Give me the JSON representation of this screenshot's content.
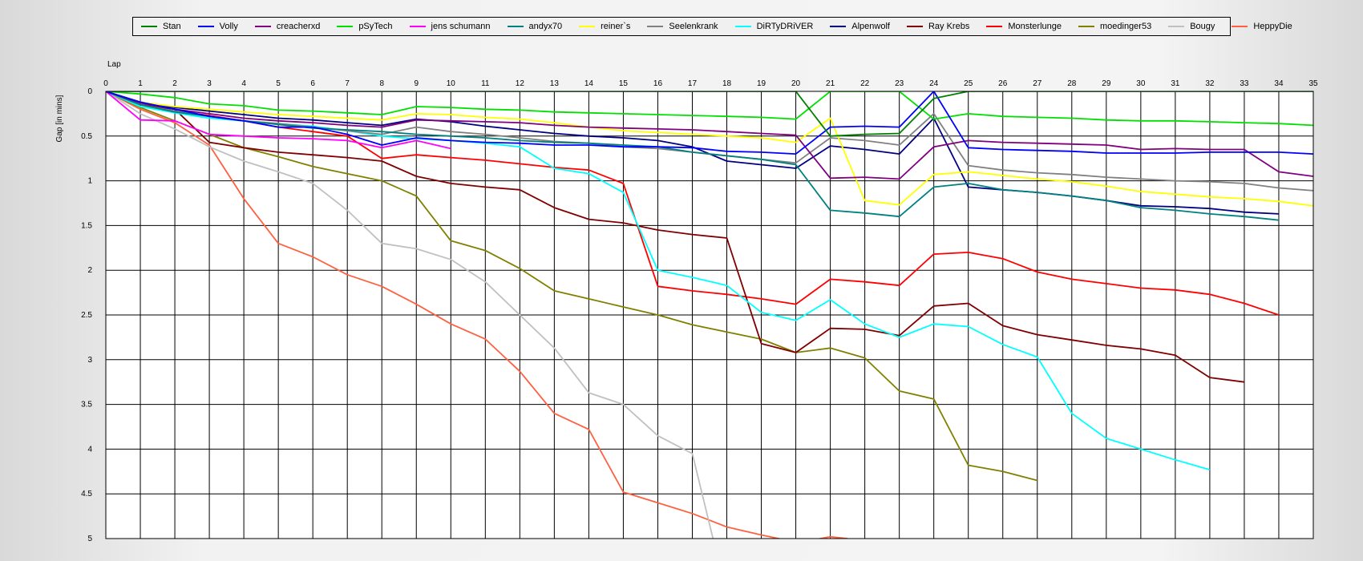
{
  "chart_data": {
    "type": "line",
    "xlabel": "Lap",
    "ylabel": "Gap [in mins]",
    "xlim": [
      0,
      35
    ],
    "ylim": [
      0,
      5
    ],
    "y_inverted": true,
    "grid": true,
    "legend_position": "top",
    "x_ticks": [
      "0",
      "1",
      "2",
      "3",
      "4",
      "5",
      "6",
      "7",
      "8",
      "9",
      "10",
      "11",
      "12",
      "13",
      "14",
      "15",
      "16",
      "17",
      "18",
      "19",
      "20",
      "21",
      "22",
      "23",
      "24",
      "25",
      "26",
      "27",
      "28",
      "29",
      "30",
      "31",
      "32",
      "33",
      "34",
      "35"
    ],
    "y_ticks": [
      "0",
      "0.5",
      "1",
      "1.5",
      "2",
      "2.5",
      "3",
      "3.5",
      "4",
      "4.5",
      "5"
    ],
    "series": [
      {
        "name": "Stan",
        "color": "#008000",
        "x": [
          0,
          1,
          2,
          3,
          4,
          5,
          6,
          7,
          8,
          9,
          10,
          11,
          12,
          13,
          14,
          15,
          16,
          17,
          18,
          19,
          20,
          21,
          22,
          23,
          24,
          25,
          26,
          27,
          28,
          29,
          30,
          31,
          32,
          33,
          34,
          35
        ],
        "values": [
          0,
          0,
          0,
          0,
          0,
          0,
          0,
          0,
          0,
          0,
          0,
          0,
          0,
          0,
          0,
          0,
          0,
          0,
          0,
          0,
          0,
          0.5,
          0.48,
          0.47,
          0.08,
          0,
          0,
          0,
          0,
          0,
          0,
          0,
          0,
          0,
          0,
          0
        ]
      },
      {
        "name": "Volly",
        "color": "#0000ff",
        "x": [
          0,
          1,
          2,
          3,
          4,
          5,
          6,
          7,
          8,
          9,
          10,
          11,
          12,
          13,
          14,
          15,
          16,
          17,
          18,
          19,
          20,
          21,
          22,
          23,
          24,
          25,
          26,
          27,
          28,
          29,
          30,
          31,
          32,
          33,
          34,
          35
        ],
        "values": [
          0,
          0.12,
          0.2,
          0.28,
          0.33,
          0.4,
          0.4,
          0.48,
          0.6,
          0.52,
          0.55,
          0.57,
          0.58,
          0.6,
          0.6,
          0.62,
          0.62,
          0.63,
          0.67,
          0.68,
          0.7,
          0.4,
          0.39,
          0.4,
          0.0,
          0.63,
          0.65,
          0.66,
          0.67,
          0.69,
          0.69,
          0.69,
          0.68,
          0.68,
          0.68,
          0.7
        ]
      },
      {
        "name": "creacherxd",
        "color": "#800080",
        "x": [
          0,
          1,
          2,
          3,
          4,
          5,
          6,
          7,
          8,
          9,
          10,
          11,
          12,
          13,
          14,
          15,
          16,
          17,
          18,
          19,
          20,
          21,
          22,
          23,
          24,
          25,
          26,
          27,
          28,
          29,
          30,
          31,
          32,
          33,
          34,
          35
        ],
        "values": [
          0,
          0.13,
          0.2,
          0.25,
          0.3,
          0.33,
          0.35,
          0.38,
          0.4,
          0.32,
          0.33,
          0.34,
          0.35,
          0.38,
          0.4,
          0.41,
          0.42,
          0.43,
          0.45,
          0.47,
          0.49,
          0.97,
          0.96,
          0.98,
          0.62,
          0.55,
          0.57,
          0.58,
          0.59,
          0.6,
          0.65,
          0.64,
          0.65,
          0.65,
          0.9,
          0.95
        ]
      },
      {
        "name": "pSyTech",
        "color": "#00e000",
        "x": [
          0,
          1,
          2,
          3,
          4,
          5,
          6,
          7,
          8,
          9,
          10,
          11,
          12,
          13,
          14,
          15,
          16,
          17,
          18,
          19,
          20,
          21,
          22,
          23,
          24,
          25,
          26,
          27,
          28,
          29,
          30,
          31,
          32,
          33,
          34,
          35
        ],
        "values": [
          0,
          0.03,
          0.07,
          0.14,
          0.16,
          0.21,
          0.22,
          0.24,
          0.26,
          0.17,
          0.18,
          0.2,
          0.21,
          0.23,
          0.24,
          0.25,
          0.26,
          0.27,
          0.28,
          0.29,
          0.31,
          0.0,
          0.0,
          0.0,
          0.31,
          0.25,
          0.28,
          0.29,
          0.3,
          0.32,
          0.33,
          0.33,
          0.34,
          0.35,
          0.36,
          0.38
        ]
      },
      {
        "name": "jens  schumann",
        "color": "#ff00ff",
        "x": [
          0,
          1,
          2,
          3,
          4,
          5,
          6,
          7,
          8,
          9,
          10
        ],
        "values": [
          0,
          0.32,
          0.33,
          0.48,
          0.5,
          0.52,
          0.53,
          0.55,
          0.63,
          0.55,
          0.64
        ]
      },
      {
        "name": "andyx70",
        "color": "#008080",
        "x": [
          0,
          1,
          2,
          3,
          4,
          5,
          6,
          7,
          8,
          9,
          10,
          11,
          12,
          13,
          14,
          15,
          16,
          17,
          18,
          19,
          20,
          21,
          22,
          23,
          24,
          25,
          26,
          27,
          28,
          29,
          30,
          31,
          32,
          33,
          34
        ],
        "values": [
          0,
          0.15,
          0.23,
          0.28,
          0.33,
          0.37,
          0.41,
          0.43,
          0.45,
          0.48,
          0.5,
          0.52,
          0.55,
          0.57,
          0.58,
          0.6,
          0.62,
          0.68,
          0.72,
          0.76,
          0.82,
          1.33,
          1.36,
          1.4,
          1.07,
          1.03,
          1.1,
          1.13,
          1.17,
          1.22,
          1.3,
          1.33,
          1.37,
          1.4,
          1.44
        ]
      },
      {
        "name": "reiner`s",
        "color": "#ffff00",
        "x": [
          0,
          1,
          2,
          3,
          4,
          5,
          6,
          7,
          8,
          9,
          10,
          11,
          12,
          13,
          14,
          15,
          16,
          17,
          18,
          19,
          20,
          21,
          22,
          23,
          24,
          25,
          26,
          27,
          28,
          29,
          30,
          31,
          32,
          33,
          34,
          35
        ],
        "values": [
          0,
          0.12,
          0.17,
          0.2,
          0.23,
          0.26,
          0.28,
          0.3,
          0.32,
          0.25,
          0.26,
          0.29,
          0.31,
          0.35,
          0.4,
          0.44,
          0.46,
          0.48,
          0.5,
          0.52,
          0.57,
          0.3,
          1.22,
          1.27,
          0.93,
          0.9,
          0.94,
          0.98,
          1.01,
          1.06,
          1.12,
          1.15,
          1.18,
          1.2,
          1.23,
          1.28
        ]
      },
      {
        "name": "Seelenkrank",
        "color": "#808080",
        "x": [
          0,
          1,
          2,
          3,
          4,
          5,
          6,
          7,
          8,
          9,
          10,
          11,
          12,
          13,
          14,
          15,
          16,
          17,
          18,
          19,
          20,
          21,
          22,
          23,
          24,
          25,
          26,
          27,
          28,
          29,
          30,
          31,
          32,
          33,
          34,
          35
        ],
        "values": [
          0,
          0.15,
          0.22,
          0.28,
          0.33,
          0.36,
          0.4,
          0.44,
          0.48,
          0.4,
          0.45,
          0.48,
          0.52,
          0.56,
          0.58,
          0.62,
          0.64,
          0.68,
          0.72,
          0.76,
          0.8,
          0.52,
          0.55,
          0.6,
          0.25,
          0.83,
          0.88,
          0.91,
          0.93,
          0.96,
          0.98,
          1.0,
          1.01,
          1.03,
          1.08,
          1.11
        ]
      },
      {
        "name": "DiRTyDRiVER",
        "color": "#00ffff",
        "x": [
          0,
          1,
          2,
          3,
          4,
          5,
          6,
          7,
          8,
          9,
          10,
          11,
          12,
          13,
          14,
          15,
          16,
          17,
          18,
          19,
          20,
          21,
          22,
          23,
          24,
          25,
          26,
          27,
          28,
          29,
          30,
          31,
          32
        ],
        "values": [
          0,
          0.17,
          0.24,
          0.3,
          0.33,
          0.36,
          0.39,
          0.44,
          0.5,
          0.53,
          0.55,
          0.58,
          0.62,
          0.86,
          0.92,
          1.13,
          2.0,
          2.08,
          2.17,
          2.47,
          2.56,
          2.33,
          2.6,
          2.75,
          2.6,
          2.63,
          2.83,
          2.97,
          3.6,
          3.88,
          4.0,
          4.12,
          4.23
        ]
      },
      {
        "name": "Alpenwolf",
        "color": "#000080",
        "x": [
          0,
          1,
          2,
          3,
          4,
          5,
          6,
          7,
          8,
          9,
          10,
          11,
          12,
          13,
          14,
          15,
          16,
          17,
          18,
          19,
          20,
          21,
          22,
          23,
          24,
          25,
          26,
          27,
          28,
          29,
          30,
          31,
          32,
          33,
          34
        ],
        "values": [
          0,
          0.12,
          0.18,
          0.22,
          0.26,
          0.3,
          0.32,
          0.35,
          0.38,
          0.31,
          0.34,
          0.39,
          0.43,
          0.47,
          0.5,
          0.52,
          0.55,
          0.62,
          0.78,
          0.82,
          0.86,
          0.61,
          0.65,
          0.7,
          0.3,
          1.07,
          1.1,
          1.13,
          1.17,
          1.22,
          1.28,
          1.29,
          1.31,
          1.35,
          1.37
        ]
      },
      {
        "name": "Ray Krebs",
        "color": "#800000",
        "x": [
          0,
          1,
          2,
          3,
          4,
          5,
          6,
          7,
          8,
          9,
          10,
          11,
          12,
          13,
          14,
          15,
          16,
          17,
          18,
          19,
          20,
          21,
          22,
          23,
          24,
          25,
          26,
          27,
          28,
          29,
          30,
          31,
          32,
          33
        ],
        "values": [
          0,
          0.15,
          0.2,
          0.57,
          0.63,
          0.68,
          0.71,
          0.74,
          0.78,
          0.95,
          1.03,
          1.07,
          1.1,
          1.3,
          1.43,
          1.47,
          1.55,
          1.6,
          1.64,
          2.82,
          2.92,
          2.65,
          2.66,
          2.73,
          2.4,
          2.37,
          2.62,
          2.72,
          2.78,
          2.84,
          2.88,
          2.95,
          3.2,
          3.25
        ]
      },
      {
        "name": "Monsterlunge",
        "color": "#ff0000",
        "x": [
          0,
          1,
          2,
          3,
          4,
          5,
          6,
          7,
          8,
          9,
          10,
          11,
          12,
          13,
          14,
          15,
          16,
          17,
          18,
          19,
          20,
          21,
          22,
          23,
          24,
          25,
          26,
          27,
          28,
          29,
          30,
          31,
          32,
          33,
          34
        ],
        "values": [
          0,
          0.15,
          0.22,
          0.27,
          0.33,
          0.4,
          0.45,
          0.5,
          0.75,
          0.71,
          0.74,
          0.77,
          0.81,
          0.85,
          0.88,
          1.03,
          2.18,
          2.23,
          2.27,
          2.32,
          2.38,
          2.1,
          2.13,
          2.17,
          1.82,
          1.8,
          1.87,
          2.02,
          2.1,
          2.15,
          2.2,
          2.22,
          2.27,
          2.37,
          2.5
        ]
      },
      {
        "name": "moedinger53",
        "color": "#808000",
        "x": [
          0,
          1,
          2,
          3,
          4,
          5,
          6,
          7,
          8,
          9,
          10,
          11,
          12,
          13,
          14,
          15,
          16,
          17,
          18,
          19,
          20,
          21,
          22,
          23,
          24,
          25,
          26,
          27
        ],
        "values": [
          0,
          0.18,
          0.33,
          0.48,
          0.63,
          0.73,
          0.84,
          0.92,
          1.0,
          1.17,
          1.67,
          1.78,
          1.98,
          2.23,
          2.32,
          2.41,
          2.5,
          2.61,
          2.69,
          2.77,
          2.92,
          2.87,
          2.98,
          3.35,
          3.44,
          4.18,
          4.25,
          4.35
        ]
      },
      {
        "name": "Bougy",
        "color": "#c0c0c0",
        "x": [
          0,
          1,
          2,
          3,
          4,
          5,
          6,
          7,
          8,
          9,
          10,
          11,
          12,
          13,
          14,
          15,
          16,
          17,
          17.6
        ],
        "values": [
          0,
          0.25,
          0.42,
          0.62,
          0.78,
          0.9,
          1.03,
          1.33,
          1.7,
          1.76,
          1.88,
          2.13,
          2.5,
          2.87,
          3.37,
          3.5,
          3.85,
          4.05,
          5
        ]
      },
      {
        "name": "HeppyDie",
        "color": "#ff6040",
        "x": [
          0,
          1,
          2,
          3,
          4,
          5,
          6,
          7,
          8,
          9,
          10,
          11,
          12,
          13,
          14,
          15,
          16,
          17,
          18,
          19,
          19.5,
          20,
          21,
          21.5
        ],
        "values": [
          0,
          0.2,
          0.35,
          0.6,
          1.2,
          1.7,
          1.85,
          2.05,
          2.18,
          2.38,
          2.6,
          2.77,
          3.13,
          3.6,
          3.78,
          4.48,
          4.6,
          4.72,
          4.87,
          4.96,
          5,
          5.05,
          4.98,
          5
        ]
      }
    ]
  }
}
